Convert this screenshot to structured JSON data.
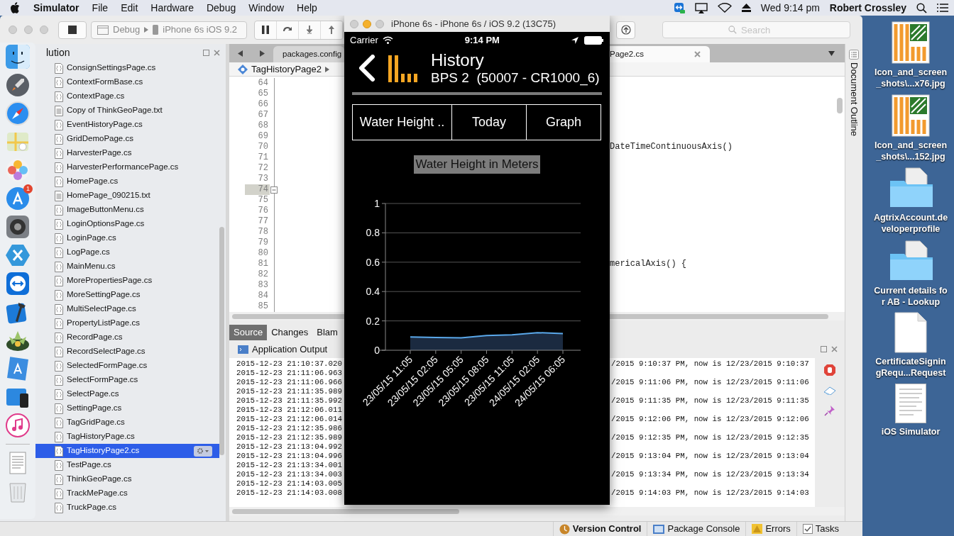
{
  "menu_bar": {
    "app": "Simulator",
    "menus": [
      "File",
      "Edit",
      "Hardware",
      "Debug",
      "Window",
      "Help"
    ],
    "clock": "Wed 9:14 pm",
    "user": "Robert Crossley"
  },
  "ide": {
    "toolbar": {
      "configuration": "Debug",
      "device": "iPhone 6s iOS 9.2",
      "search": {
        "placeholder": "Search"
      }
    },
    "solution_pad": {
      "title": "lution",
      "files": [
        {
          "name": "ConsignSettingsPage.cs",
          "kind": "code",
          "selected": false
        },
        {
          "name": "ContextFormBase.cs",
          "kind": "code",
          "selected": false
        },
        {
          "name": "ContextPage.cs",
          "kind": "code",
          "selected": false
        },
        {
          "name": "Copy of ThinkGeoPage.txt",
          "kind": "text",
          "selected": false
        },
        {
          "name": "EventHistoryPage.cs",
          "kind": "code",
          "selected": false
        },
        {
          "name": "GridDemoPage.cs",
          "kind": "code",
          "selected": false
        },
        {
          "name": "HarvesterPage.cs",
          "kind": "code",
          "selected": false
        },
        {
          "name": "HarvesterPerformancePage.cs",
          "kind": "code",
          "selected": false
        },
        {
          "name": "HomePage.cs",
          "kind": "code",
          "selected": false
        },
        {
          "name": "HomePage_090215.txt",
          "kind": "text",
          "selected": false
        },
        {
          "name": "ImageButtonMenu.cs",
          "kind": "code",
          "selected": false
        },
        {
          "name": "LoginOptionsPage.cs",
          "kind": "code",
          "selected": false
        },
        {
          "name": "LoginPage.cs",
          "kind": "code",
          "selected": false
        },
        {
          "name": "LogPage.cs",
          "kind": "code",
          "selected": false
        },
        {
          "name": "MainMenu.cs",
          "kind": "code",
          "selected": false
        },
        {
          "name": "MorePropertiesPage.cs",
          "kind": "code",
          "selected": false
        },
        {
          "name": "MoreSettingPage.cs",
          "kind": "code",
          "selected": false
        },
        {
          "name": "MultiSelectPage.cs",
          "kind": "code",
          "selected": false
        },
        {
          "name": "PropertyListPage.cs",
          "kind": "code",
          "selected": false
        },
        {
          "name": "RecordPage.cs",
          "kind": "code",
          "selected": false
        },
        {
          "name": "RecordSelectPage.cs",
          "kind": "code",
          "selected": false
        },
        {
          "name": "SelectedFormPage.cs",
          "kind": "code",
          "selected": false
        },
        {
          "name": "SelectFormPage.cs",
          "kind": "code",
          "selected": false
        },
        {
          "name": "SelectPage.cs",
          "kind": "code",
          "selected": false
        },
        {
          "name": "SettingPage.cs",
          "kind": "code",
          "selected": false
        },
        {
          "name": "TagGridPage.cs",
          "kind": "code",
          "selected": false
        },
        {
          "name": "TagHistoryPage.cs",
          "kind": "code",
          "selected": false
        },
        {
          "name": "TagHistoryPage2.cs",
          "kind": "code",
          "selected": true
        },
        {
          "name": "TestPage.cs",
          "kind": "code",
          "selected": false
        },
        {
          "name": "ThinkGeoPage.cs",
          "kind": "code",
          "selected": false
        },
        {
          "name": "TrackMePage.cs",
          "kind": "code",
          "selected": false
        },
        {
          "name": "TruckPage.cs",
          "kind": "code",
          "selected": false
        }
      ]
    },
    "editor": {
      "tabs": [
        {
          "label": "packages.config",
          "selected": false
        },
        {
          "label": "Page2.cs",
          "selected": true
        }
      ],
      "breadcrumb": "TagHistoryPage2",
      "lines": [
        {
          "number": "64",
          "current": false
        },
        {
          "number": "65",
          "current": false
        },
        {
          "number": "66",
          "current": false
        },
        {
          "number": "67",
          "current": false
        },
        {
          "number": "68",
          "current": false
        },
        {
          "number": "69",
          "current": false
        },
        {
          "number": "70",
          "current": false,
          "code": "DateTimeContinuousAxis()"
        },
        {
          "number": "71",
          "current": false
        },
        {
          "number": "72",
          "current": false
        },
        {
          "number": "73",
          "current": false
        },
        {
          "number": "74",
          "current": true
        },
        {
          "number": "75",
          "current": false
        },
        {
          "number": "76",
          "current": false
        },
        {
          "number": "77",
          "current": false
        },
        {
          "number": "78",
          "current": false
        },
        {
          "number": "79",
          "current": false
        },
        {
          "number": "80",
          "current": false
        },
        {
          "number": "81",
          "current": false,
          "code": "mericalAxis() {"
        },
        {
          "number": "82",
          "current": false
        },
        {
          "number": "83",
          "current": false
        },
        {
          "number": "84",
          "current": false
        },
        {
          "number": "85",
          "current": false
        }
      ]
    },
    "bottom_tabs": [
      {
        "label": "Source",
        "selected": true
      },
      {
        "label": "Changes",
        "selected": false
      },
      {
        "label": "Blam",
        "selected": false
      }
    ],
    "output": {
      "title": "Application Output",
      "lines": [
        {
          "timestamp": "2015-12-23 21:10:37.020",
          "message": "/2015 9:10:37 PM, now is 12/23/2015 9:10:37"
        },
        {
          "timestamp": "2015-12-23 21:11:06.963"
        },
        {
          "timestamp": "2015-12-23 21:11:06.966",
          "message": "/2015 9:11:06 PM, now is 12/23/2015 9:11:06"
        },
        {
          "timestamp": "2015-12-23 21:11:35.989"
        },
        {
          "timestamp": "2015-12-23 21:11:35.992",
          "message": "/2015 9:11:35 PM, now is 12/23/2015 9:11:35"
        },
        {
          "timestamp": "2015-12-23 21:12:06.011"
        },
        {
          "timestamp": "2015-12-23 21:12:06.014",
          "message": "/2015 9:12:06 PM, now is 12/23/2015 9:12:06"
        },
        {
          "timestamp": "2015-12-23 21:12:35.986"
        },
        {
          "timestamp": "2015-12-23 21:12:35.989",
          "message": "/2015 9:12:35 PM, now is 12/23/2015 9:12:35"
        },
        {
          "timestamp": "2015-12-23 21:13:04.992"
        },
        {
          "timestamp": "2015-12-23 21:13:04.996",
          "message": "/2015 9:13:04 PM, now is 12/23/2015 9:13:04"
        },
        {
          "timestamp": "2015-12-23 21:13:34.001"
        },
        {
          "timestamp": "2015-12-23 21:13:34.003",
          "message": "/2015 9:13:34 PM, now is 12/23/2015 9:13:34"
        },
        {
          "timestamp": "2015-12-23 21:14:03.005"
        },
        {
          "timestamp": "2015-12-23 21:14:03.008",
          "message": "/2015 9:14:03 PM, now is 12/23/2015 9:14:03"
        }
      ]
    },
    "side_tab": "Document Outline",
    "status_bar": [
      {
        "label": "Version Control",
        "kind": "vcs"
      },
      {
        "label": "Package Console",
        "kind": "console"
      },
      {
        "label": "Errors",
        "kind": "errors"
      },
      {
        "label": "Tasks",
        "kind": "tasks"
      }
    ]
  },
  "simulator": {
    "title": "iPhone 6s - iPhone 6s / iOS 9.2 (13C75)",
    "carrier": "Carrier",
    "time": "9:14 PM",
    "heading": "History",
    "subheading": "BPS 2  (50007 - CR1000_6)",
    "buttons": [
      "Water Height ..",
      "Today",
      "Graph"
    ],
    "chart_data": {
      "type": "line",
      "title": "Water Height in Meters",
      "categories": [
        "23/05/15 11:05",
        "23/05/15 02:05",
        "23/05/15 05:05",
        "23/05/15 08:05",
        "23/05/15 11:05",
        "24/05/15 02:05",
        "24/05/15 06:05"
      ],
      "series": [
        {
          "color": "#5aa8ea",
          "values": [
            0.09,
            0.087,
            0.085,
            0.1,
            0.105,
            0.12,
            0.113
          ]
        }
      ],
      "ylim": [
        0,
        1
      ],
      "yticks": [
        0,
        0.2,
        0.4,
        0.6,
        0.8,
        1
      ],
      "grid": true
    }
  },
  "dock": {
    "badge": "1"
  },
  "desktop_icons": [
    {
      "label": "Icon_and_screen_shots\\...x76.jpg",
      "kind": "image"
    },
    {
      "label": "Icon_and_screen_shots\\...152.jpg",
      "kind": "image"
    },
    {
      "label": "AgtrixAccount.developerprofile",
      "kind": "folder"
    },
    {
      "label": "Current details for AB - Lookup",
      "kind": "folder"
    },
    {
      "label": "CertificateSigningRequ...Request",
      "kind": "document"
    },
    {
      "label": "iOS Simulator",
      "kind": "screenshot"
    }
  ]
}
